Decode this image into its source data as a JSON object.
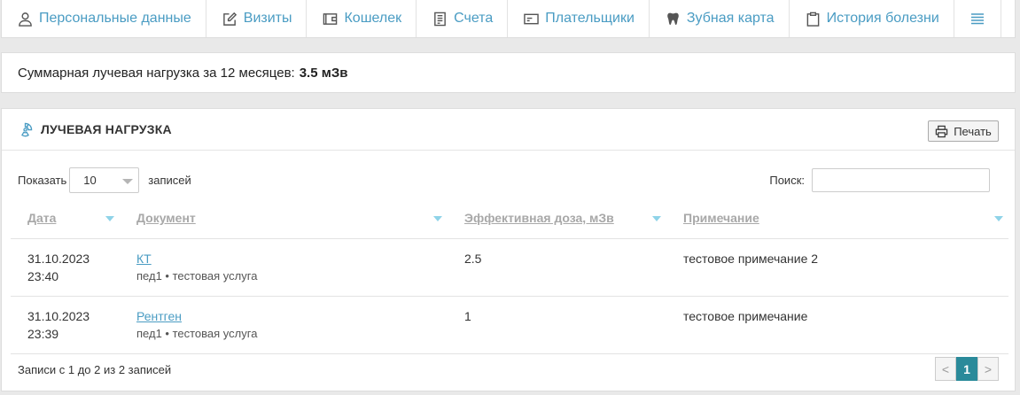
{
  "tabs": [
    {
      "label": "Персональные данные",
      "icon": "user-icon"
    },
    {
      "label": "Визиты",
      "icon": "edit-icon"
    },
    {
      "label": "Кошелек",
      "icon": "wallet-icon"
    },
    {
      "label": "Счета",
      "icon": "invoice-icon"
    },
    {
      "label": "Плательщики",
      "icon": "card-icon"
    },
    {
      "label": "Зубная карта",
      "icon": "tooth-icon"
    },
    {
      "label": "История болезни",
      "icon": "clipboard-icon"
    }
  ],
  "summary": {
    "label": "Суммарная лучевая нагрузка за 12 месяцев:",
    "value": "3.5 мЗв"
  },
  "panel": {
    "title": "ЛУЧЕВАЯ НАГРУЗКА",
    "print_label": "Печать"
  },
  "controls": {
    "show_label": "Показать",
    "page_size": "10",
    "records_label": "записей",
    "search_label": "Поиск:",
    "search_value": ""
  },
  "table": {
    "headers": [
      "Дата",
      "Документ",
      "Эффективная доза, мЗв",
      "Примечание"
    ],
    "rows": [
      {
        "date": "31.10.2023",
        "time": "23:40",
        "doc": "КТ",
        "doc_sub": "пед1 • тестовая услуга",
        "dose": "2.5",
        "note": "тестовое примечание 2"
      },
      {
        "date": "31.10.2023",
        "time": "23:39",
        "doc": "Рентген",
        "doc_sub": "пед1 • тестовая услуга",
        "dose": "1",
        "note": "тестовое примечание"
      }
    ]
  },
  "footer": {
    "info": "Записи с 1 до 2 из 2 записей",
    "prev": "<",
    "page": "1",
    "next": ">"
  },
  "colors": {
    "link": "#4a9cc3",
    "pager_active": "#2a8a9a",
    "sort_arrow": "#8fd3e8"
  }
}
